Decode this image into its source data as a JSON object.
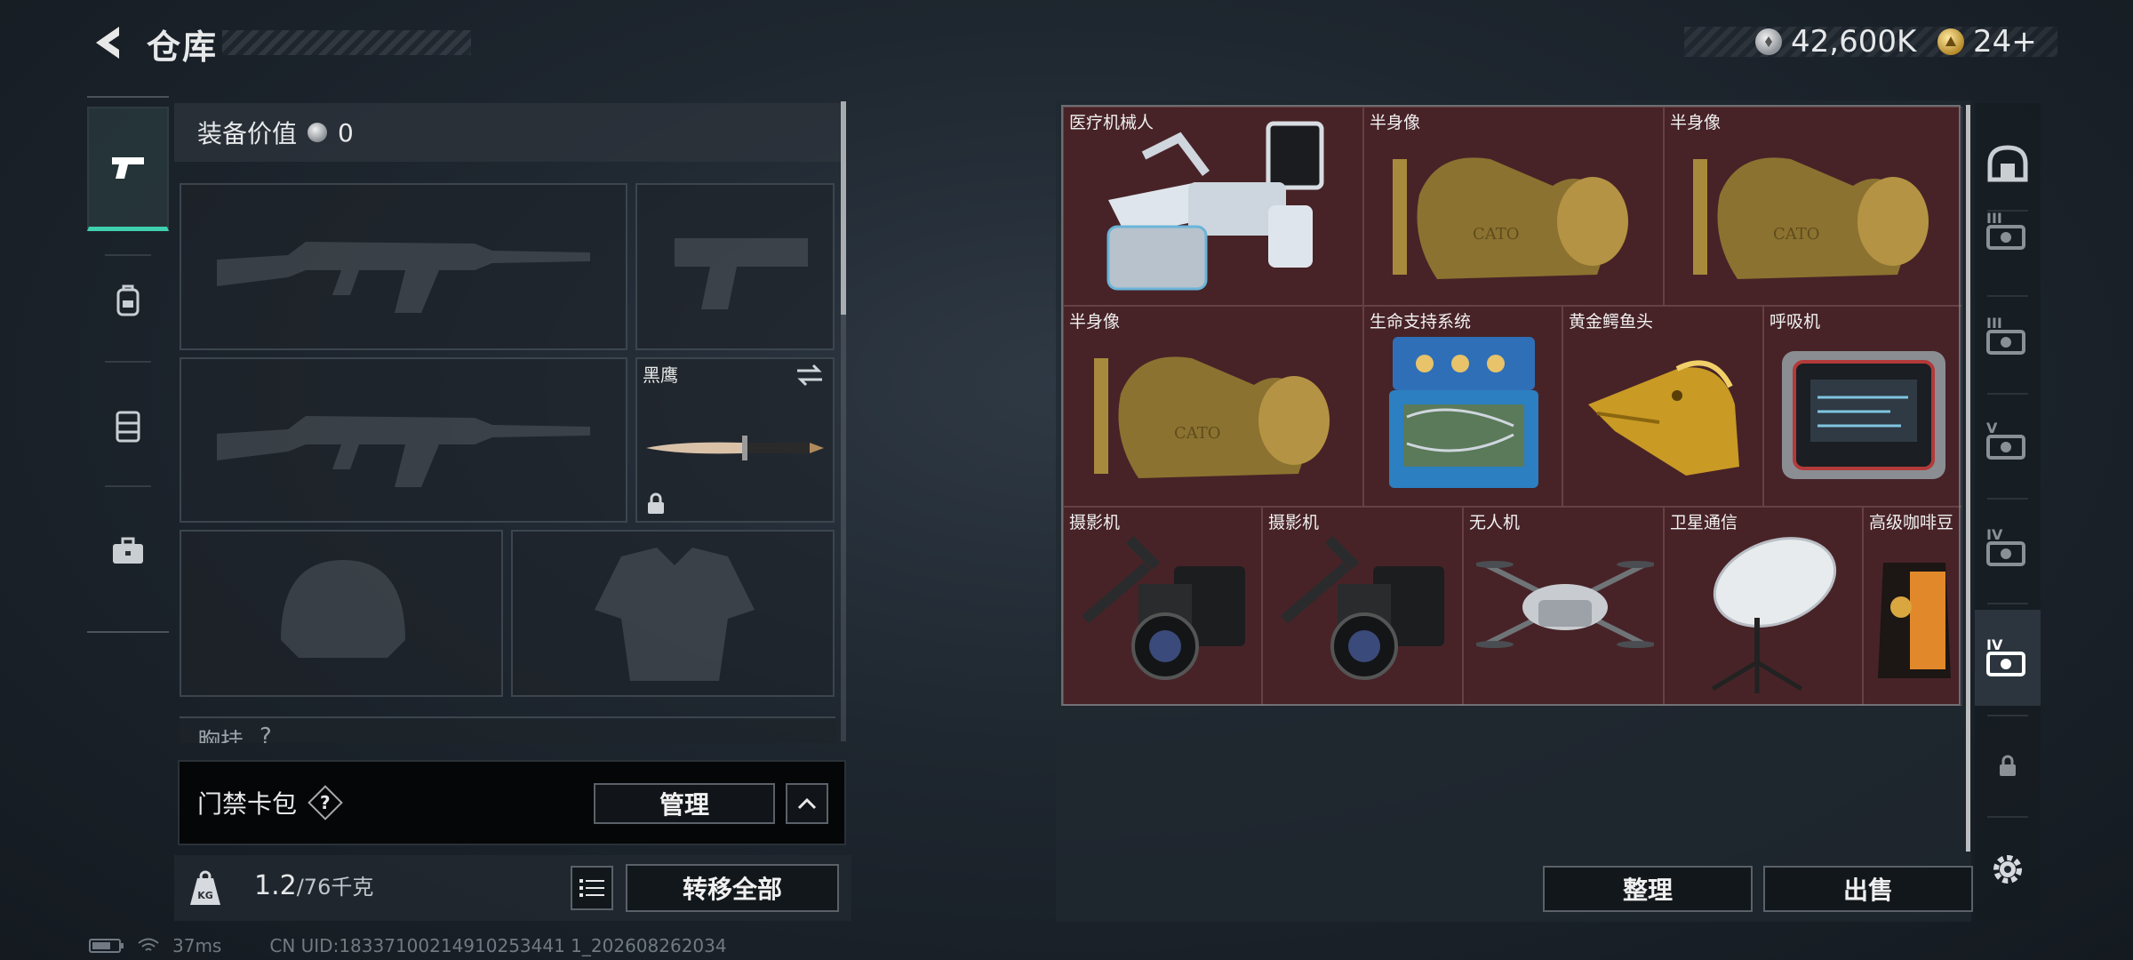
{
  "header": {
    "title": "仓库"
  },
  "currency": {
    "silver": "42,600K",
    "gold": "24+"
  },
  "left_tabs": [
    "weapons",
    "backpack",
    "rig",
    "case"
  ],
  "loadout": {
    "value_label": "装备价值",
    "value": "0",
    "melee_name": "黑鹰",
    "chest_label": "胸挂",
    "chest_hint": "?"
  },
  "keycard": {
    "label": "门禁卡包",
    "help": "?",
    "manage_label": "管理"
  },
  "capacity": {
    "current": "1.2",
    "max": "/76千克",
    "weight_tag": "KG"
  },
  "transfer_all_label": "转移全部",
  "status": {
    "ping": "37ms",
    "uid": "CN UID:18337100214910253441 1_202608262034"
  },
  "stash_items": [
    {
      "label": "医疗机械人",
      "icon": "medical-robot"
    },
    {
      "label": "半身像",
      "icon": "bust"
    },
    {
      "label": "半身像",
      "icon": "bust"
    },
    {
      "label": "半身像",
      "icon": "bust"
    },
    {
      "label": "生命支持系统",
      "icon": "life-support"
    },
    {
      "label": "黄金鳄鱼头",
      "icon": "gold-croc-head"
    },
    {
      "label": "呼吸机",
      "icon": "ventilator"
    },
    {
      "label": "摄影机",
      "icon": "camera"
    },
    {
      "label": "摄影机",
      "icon": "camera"
    },
    {
      "label": "无人机",
      "icon": "drone"
    },
    {
      "label": "卫星通信",
      "icon": "satellite-dish"
    },
    {
      "label": "高级咖啡豆",
      "icon": "coffee-beans"
    }
  ],
  "actions": {
    "organize_label": "整理",
    "sell_label": "出售"
  },
  "side_tabs": [
    "stash-dome",
    "tier-III-a",
    "tier-III-b",
    "tier-V",
    "tier-IV",
    "tier-IV-active",
    "locked"
  ],
  "side_roman": {
    "t3a": "III",
    "t3b": "III",
    "t5": "V",
    "t4": "IV",
    "t4b": "IV"
  }
}
